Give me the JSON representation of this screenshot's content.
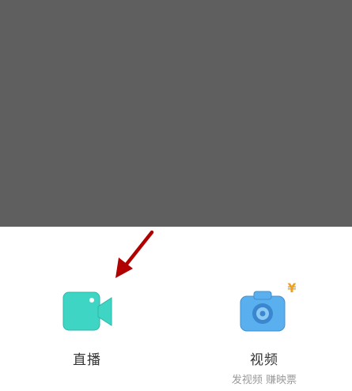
{
  "options": [
    {
      "label": "直播",
      "sublabel": ""
    },
    {
      "label": "视频",
      "sublabel": "发视频 赚映票",
      "badge": "¥"
    }
  ],
  "icons": {
    "live": "video-camera-icon",
    "video": "camera-icon",
    "arrow": "red-arrow-pointer-icon"
  },
  "colors": {
    "overlay": "#5f5f5f",
    "live_icon": "#3fd5c5",
    "video_icon": "#5ab0ee",
    "badge_text": "#f0a020",
    "arrow": "#b00000"
  }
}
